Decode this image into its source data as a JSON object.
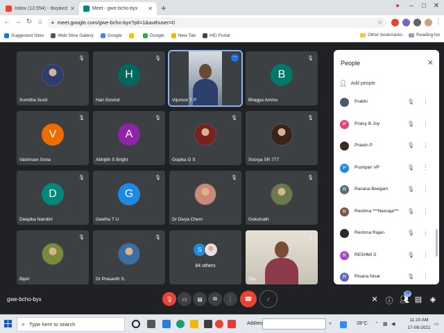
{
  "browser": {
    "tabs": [
      {
        "title": "Inbox (12,554) - divyavchem@gm",
        "favicon_color": "#ea4335"
      },
      {
        "title": "Meet - gwe-bcho-byx",
        "favicon_color": "#00897b"
      }
    ],
    "url": "meet.google.com/gwe-bcho-byx?pli=1&authuser=0",
    "bookmarks": [
      {
        "label": "Suggested Sites",
        "icon_color": "#1a73e8"
      },
      {
        "label": "Web Slice Gallery",
        "icon_color": "#555555"
      },
      {
        "label": "Google",
        "icon_color": "#4285f4"
      },
      {
        "label": "Google",
        "icon_color": "#fbbc04"
      },
      {
        "label": "Google",
        "icon_color": "#34a853"
      },
      {
        "label": "New Tab",
        "icon_color": "#f4b400"
      },
      {
        "label": "HEI Portal",
        "icon_color": "#444444"
      }
    ],
    "other_bookmarks": "Other bookmarks",
    "reading_list": "Reading list"
  },
  "meet": {
    "tiles": [
      {
        "name": "Sumitha Sunil",
        "kind": "photo",
        "color": "#2c3e70"
      },
      {
        "name": "Hari Govind",
        "kind": "letter",
        "letter": "H",
        "color": "#00695c"
      },
      {
        "name": "Vijumon T P",
        "kind": "video",
        "color": "#6d7e91"
      },
      {
        "name": "Bhagya Ammu",
        "kind": "letter",
        "letter": "B",
        "color": "#00796b"
      },
      {
        "name": "Vaishnavi Sona",
        "kind": "letter",
        "letter": "V",
        "color": "#ef6c00"
      },
      {
        "name": "Abhijith S Bright",
        "kind": "letter",
        "letter": "A",
        "color": "#8e24aa"
      },
      {
        "name": "Gopika G S",
        "kind": "photo",
        "color": "#7b1f1f"
      },
      {
        "name": "Soorya SR 777",
        "kind": "photo",
        "color": "#3a2418"
      },
      {
        "name": "Deepika Nandini",
        "kind": "letter",
        "letter": "D",
        "color": "#00897b"
      },
      {
        "name": "Geethu T U",
        "kind": "letter",
        "letter": "G",
        "color": "#1e88e5"
      },
      {
        "name": "Dr Divya Chem",
        "kind": "photo",
        "color": "#c98a7a"
      },
      {
        "name": "Gokulnath",
        "kind": "photo",
        "color": "#6b7a4a"
      },
      {
        "name": "Bipin",
        "kind": "photo",
        "color": "#7a8a3a"
      },
      {
        "name": "Dr Prasanth S.",
        "kind": "photo",
        "color": "#3a6ea8"
      },
      {
        "name": "84 others",
        "kind": "others",
        "color": "#1e88e5"
      },
      {
        "name": "You",
        "kind": "self",
        "color": "#b0a898"
      }
    ],
    "others_letter": "S",
    "meeting_code": "gwe-bcho-byx",
    "people_count": "99"
  },
  "people_panel": {
    "title": "People",
    "add_label": "Add people",
    "participants": [
      {
        "name": "Prabhi",
        "letter": "",
        "color": "#4a5a6a"
      },
      {
        "name": "Praisy B Joy",
        "letter": "P",
        "color": "#ec407a"
      },
      {
        "name": "Prawin P",
        "letter": "",
        "color": "#3a2a20"
      },
      {
        "name": "Pushpan VP",
        "letter": "P",
        "color": "#1e88e5"
      },
      {
        "name": "Rasana Beegam",
        "letter": "R",
        "color": "#546e7a"
      },
      {
        "name": "Reshma ***Neeraja***",
        "letter": "R",
        "color": "#795548"
      },
      {
        "name": "Reshma Rajan",
        "letter": "",
        "color": "#2a2a2a"
      },
      {
        "name": "RESHMI S",
        "letter": "R",
        "color": "#ab47bc"
      },
      {
        "name": "Risana Nisar",
        "letter": "R",
        "color": "#5c6bc0"
      }
    ]
  },
  "taskbar": {
    "search_placeholder": "Type here to search",
    "address_label": "Address",
    "temperature": "28°C",
    "time": "11:10 AM",
    "date": "17-08-2021"
  }
}
